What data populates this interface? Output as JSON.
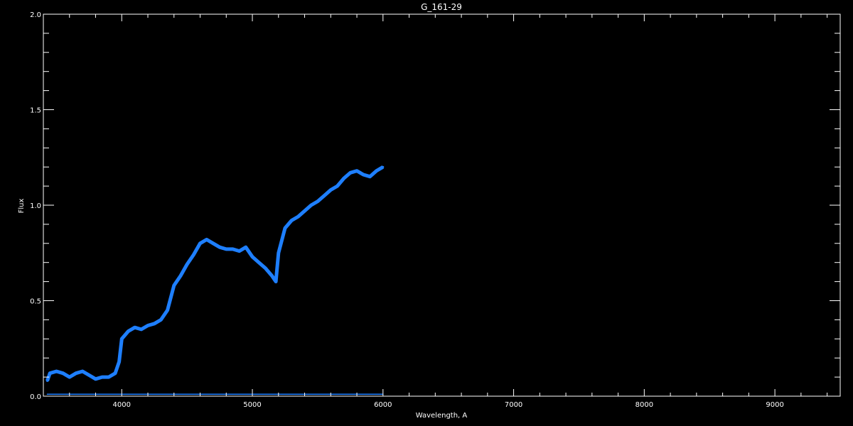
{
  "chart_data": {
    "type": "line",
    "title": "G_161-29",
    "xlabel": "Wavelength, A",
    "ylabel": "Flux",
    "xlim": [
      3400,
      9500
    ],
    "ylim": [
      0,
      2.0
    ],
    "x_ticks": [
      4000,
      5000,
      6000,
      7000,
      8000,
      9000
    ],
    "x_tick_labels": [
      "4000",
      "5000",
      "6000",
      "7000",
      "8000",
      "9000"
    ],
    "y_ticks": [
      0,
      0.5,
      1.0,
      1.5,
      2.0
    ],
    "y_tick_labels": [
      "0.0",
      "0.5",
      "1.0",
      "1.5",
      "2.0"
    ],
    "x_minor_step": 200,
    "y_minor_step": 0.1,
    "grid": false,
    "background": "#000000",
    "axis_color": "#ffffff",
    "series": [
      {
        "color": "#1e7fff",
        "x": [
          3430,
          3450,
          3500,
          3550,
          3600,
          3650,
          3700,
          3750,
          3800,
          3850,
          3900,
          3950,
          3980,
          4000,
          4050,
          4100,
          4150,
          4200,
          4250,
          4300,
          4350,
          4400,
          4450,
          4500,
          4550,
          4600,
          4650,
          4700,
          4750,
          4800,
          4850,
          4900,
          4950,
          5000,
          5050,
          5100,
          5150,
          5180,
          5200,
          5250,
          5300,
          5350,
          5400,
          5450,
          5500,
          5550,
          5600,
          5650,
          5700,
          5750,
          5800,
          5850,
          5900,
          5950,
          6000
        ],
        "values": [
          0.08,
          0.12,
          0.13,
          0.12,
          0.1,
          0.12,
          0.13,
          0.11,
          0.09,
          0.1,
          0.1,
          0.12,
          0.18,
          0.3,
          0.34,
          0.36,
          0.35,
          0.37,
          0.38,
          0.4,
          0.45,
          0.58,
          0.63,
          0.69,
          0.74,
          0.8,
          0.82,
          0.8,
          0.78,
          0.77,
          0.77,
          0.76,
          0.78,
          0.73,
          0.7,
          0.67,
          0.63,
          0.6,
          0.75,
          0.88,
          0.92,
          0.94,
          0.97,
          1.0,
          1.02,
          1.05,
          1.08,
          1.1,
          1.14,
          1.17,
          1.18,
          1.16,
          1.15,
          1.18,
          1.2
        ]
      },
      {
        "color": "#1e7fff",
        "x": [
          3430,
          6000
        ],
        "values": [
          0.01,
          0.01
        ]
      }
    ]
  }
}
